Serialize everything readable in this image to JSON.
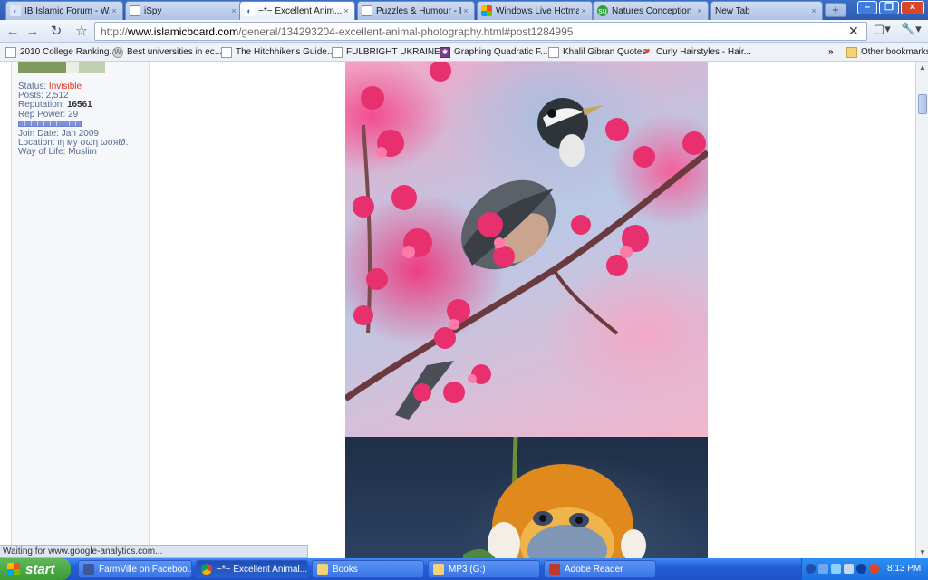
{
  "tabs": [
    {
      "title": "IB Islamic Forum - W...",
      "icon": "loading-icon"
    },
    {
      "title": "iSpy",
      "icon": "page-icon"
    },
    {
      "title": "~*~ Excellent Anim...",
      "icon": "loading-icon",
      "active": true
    },
    {
      "title": "Puzzles & Humour - I...",
      "icon": "page-icon"
    },
    {
      "title": "Windows Live Hotmail",
      "icon": "windows-icon"
    },
    {
      "title": "Natures Conception ...",
      "icon": "stumbleupon-icon"
    },
    {
      "title": "New Tab",
      "icon": "none"
    }
  ],
  "tab_close_glyph": "×",
  "new_tab_glyph": "+",
  "window_controls": {
    "minimize": "–",
    "restore": "❐",
    "close": "×"
  },
  "toolbar": {
    "back_glyph": "←",
    "forward_glyph": "→",
    "reload_glyph": "↻",
    "star_glyph": "☆",
    "url_scheme": "http://",
    "url_host": "www.islamicboard.com",
    "url_path": "/general/134293204-excellent-animal-photography.html#post1284995",
    "clear_glyph": "✕",
    "page_menu_glyph": "▢▾",
    "wrench_glyph": "🔧▾"
  },
  "bookmarks": [
    {
      "label": "2010 College Ranking...",
      "icon": "page-icon"
    },
    {
      "label": "Best universities in ec...",
      "icon": "wordpress-icon"
    },
    {
      "label": "The Hitchhiker's Guide...",
      "icon": "page-icon"
    },
    {
      "label": "FULBRIGHT UKRAINE ...",
      "icon": "page-icon"
    },
    {
      "label": "Graphing Quadratic F...",
      "icon": "math-icon"
    },
    {
      "label": "Khalil Gibran Quotes",
      "icon": "page-icon"
    },
    {
      "label": "Curly Hairstyles - Hair...",
      "icon": "heart-icon"
    }
  ],
  "bookmarks_overflow": "»",
  "other_bookmarks": "Other bookmarks",
  "userinfo": {
    "status_label": "Status:",
    "status_value": "Invisible",
    "posts": "Posts: 2,512",
    "reputation_label": "Reputation:",
    "reputation_value": "16561",
    "rep_power": "Rep Power: 29",
    "join_date": "Join Date: Jan 2009",
    "location": "Location: ιη мy σωη ωσяℓ∂.",
    "way_of_life": "Way of Life: Muslim"
  },
  "status_text": "Waiting for www.google-analytics.com...",
  "taskbar": {
    "start": "start",
    "tasks": [
      {
        "label": "FarmVille on Faceboo...",
        "color": "#3b5998"
      },
      {
        "label": "~*~ Excellent Animal...",
        "color": "#4a8cf0",
        "active": true
      },
      {
        "label": "Books",
        "color": "#f3d27a"
      },
      {
        "label": "MP3 (G:)",
        "color": "#f3d27a"
      },
      {
        "label": "Adobe Reader",
        "color": "#c0392b"
      }
    ],
    "clock": "8:13 PM"
  }
}
